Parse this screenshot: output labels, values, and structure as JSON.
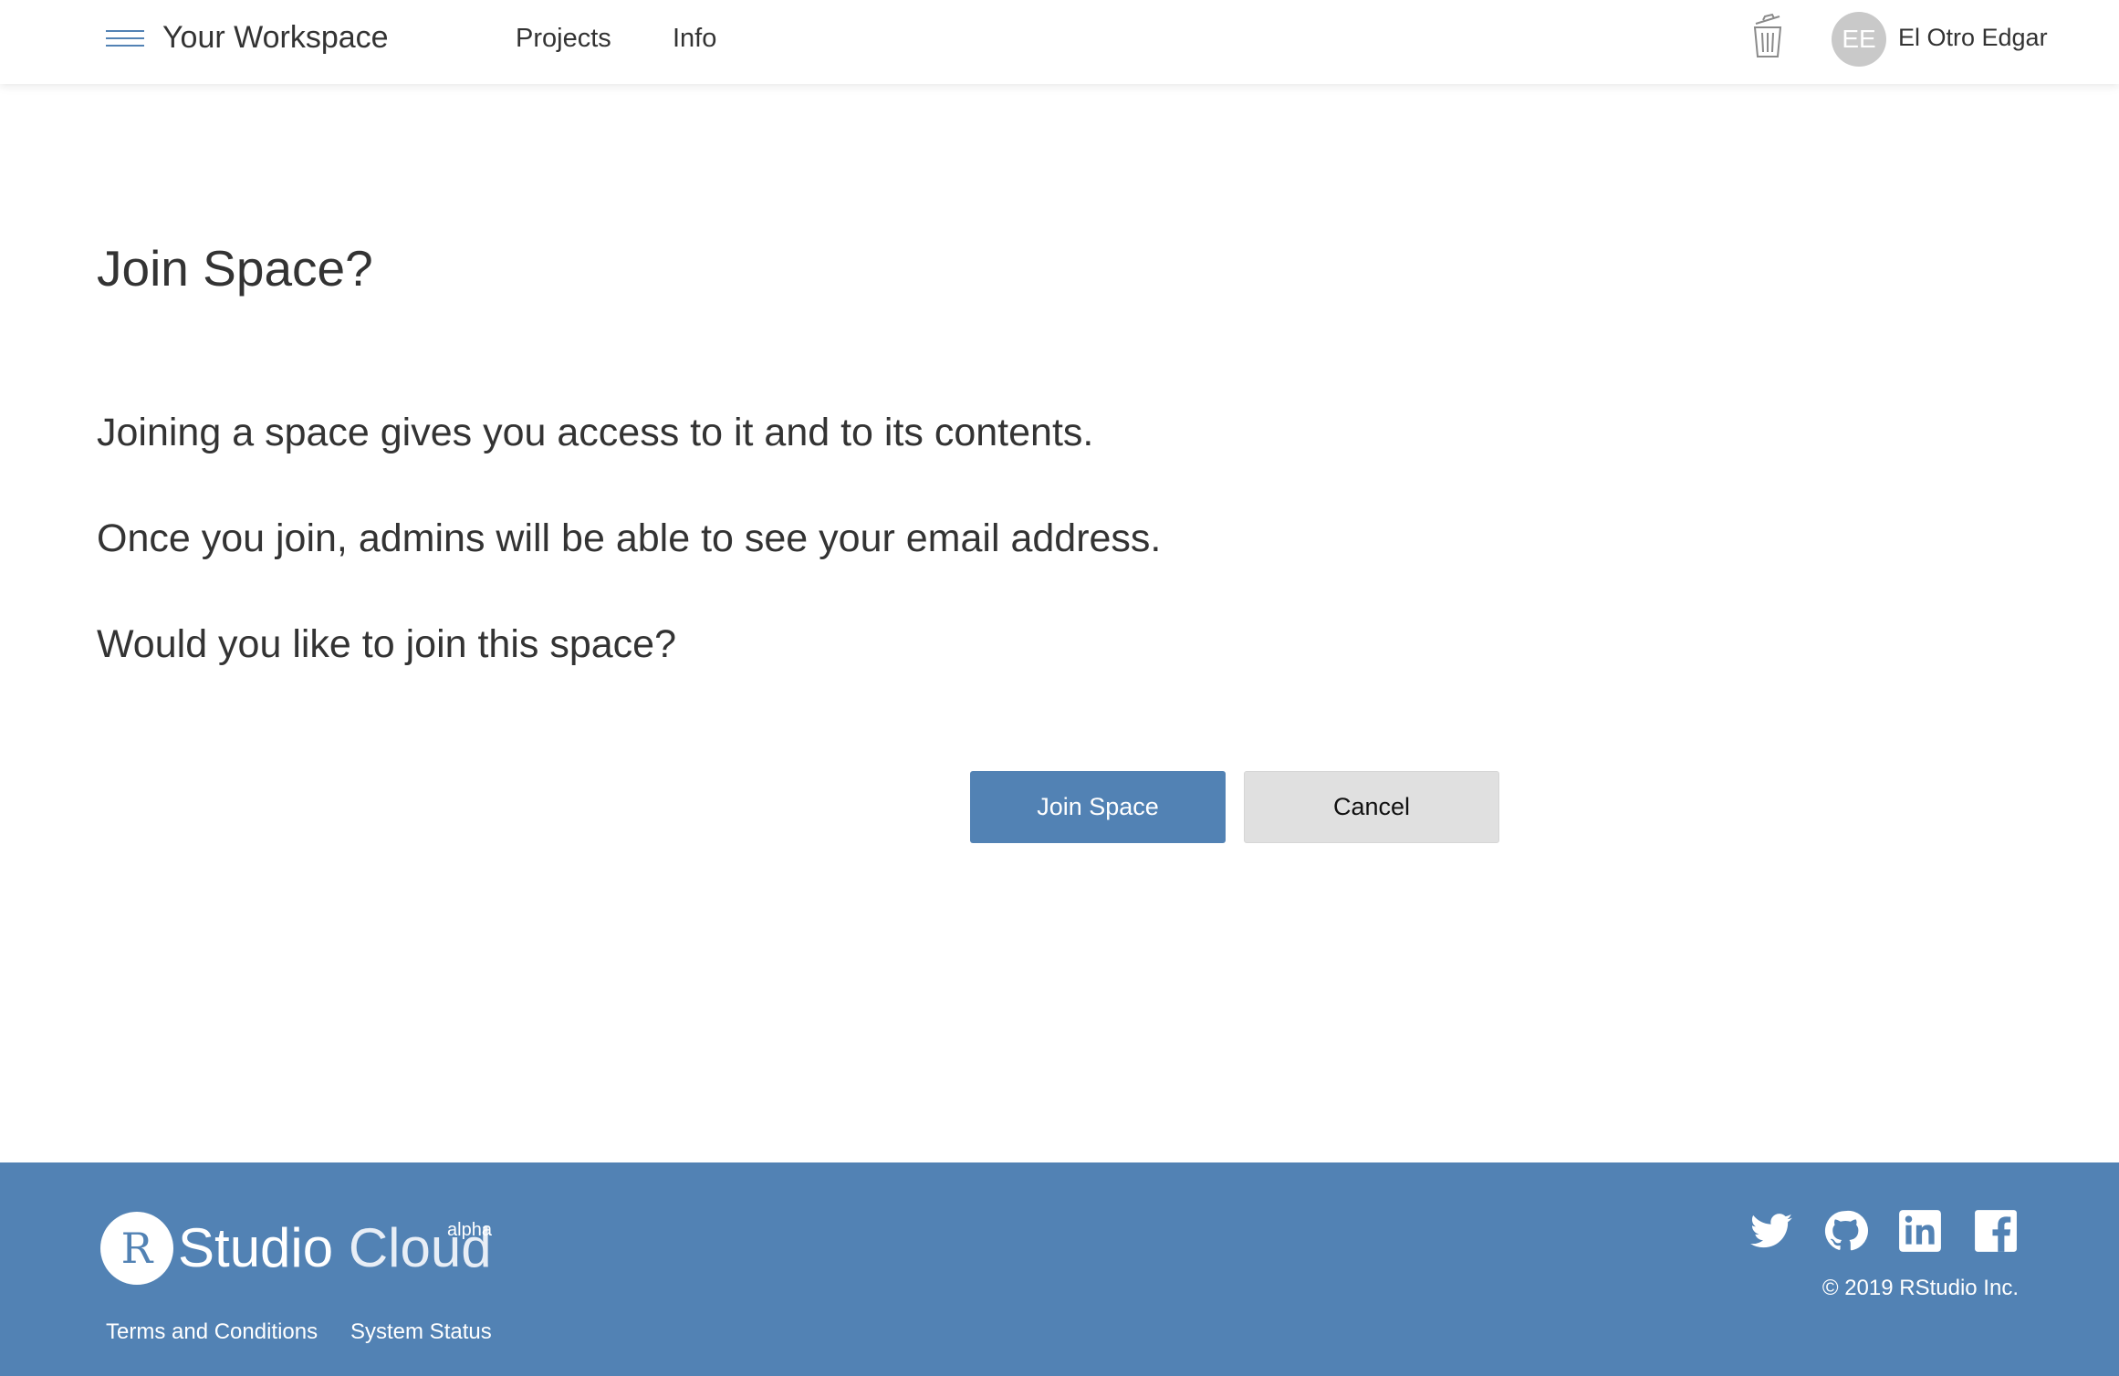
{
  "header": {
    "workspace_title": "Your Workspace",
    "nav": [
      {
        "label": "Projects"
      },
      {
        "label": "Info"
      }
    ],
    "user": {
      "initials": "EE",
      "name": "El Otro Edgar"
    }
  },
  "main": {
    "heading": "Join Space?",
    "paragraphs": [
      "Joining a space gives you access to it and to its contents.",
      "Once you join, admins will be able to see your email address.",
      "Would you like to join this space?"
    ],
    "join_button": "Join Space",
    "cancel_button": "Cancel"
  },
  "footer": {
    "logo_letter": "R",
    "logo_text_bold": "Studio",
    "logo_text_light": "Cloud",
    "logo_badge": "alpha",
    "links": [
      {
        "label": "Terms and Conditions"
      },
      {
        "label": "System Status"
      }
    ],
    "copyright": "© 2019 RStudio Inc.",
    "social_icons": [
      "twitter-icon",
      "github-icon",
      "linkedin-icon",
      "facebook-icon"
    ]
  },
  "colors": {
    "brand": "#5282b4",
    "cancel_bg": "#e0e0e0",
    "text": "#333333"
  }
}
